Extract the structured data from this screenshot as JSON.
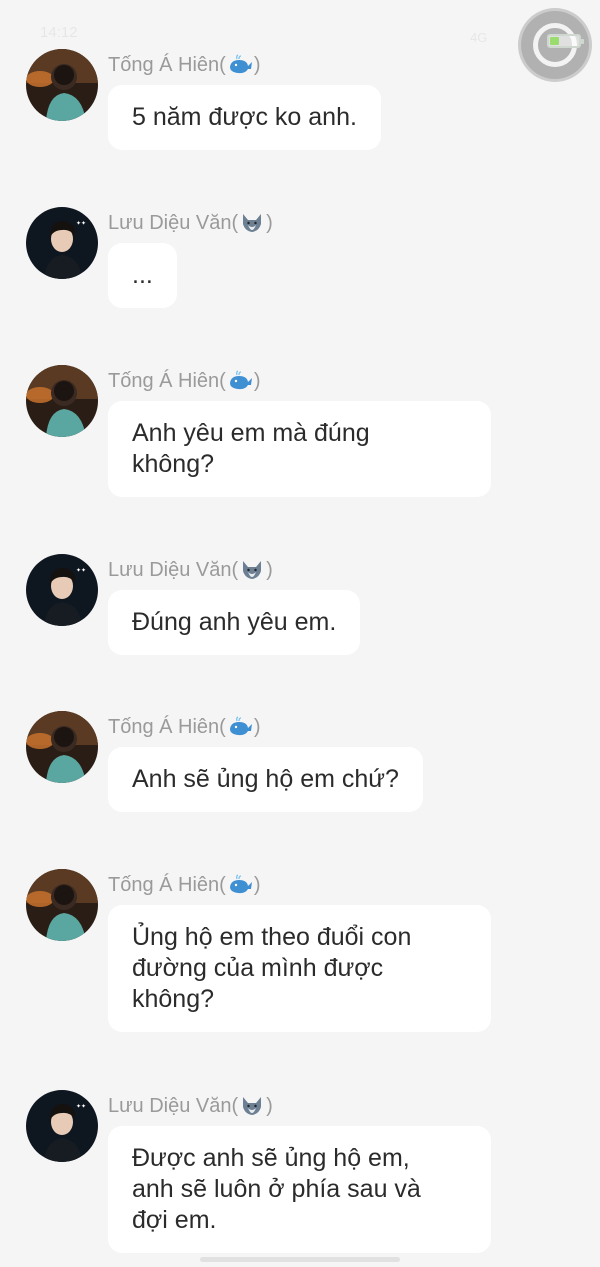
{
  "status_bar": {
    "left_text": "14:12",
    "right_text": "4G"
  },
  "senders": {
    "a": {
      "name": "Tống Á Hiên",
      "emoji": "whale-icon"
    },
    "b": {
      "name": "Lưu Diệu Văn",
      "emoji": "wolf-icon"
    }
  },
  "messages": [
    {
      "sender": "Tống Á Hiên",
      "text": "5 năm được ko anh."
    },
    {
      "sender": "Lưu Diệu Văn",
      "text": "..."
    },
    {
      "sender": "Tống Á Hiên",
      "text": "Anh yêu em mà đúng\nkhông?"
    },
    {
      "sender": "Lưu Diệu Văn",
      "text": "Đúng anh yêu em."
    },
    {
      "sender": "Tống Á Hiên",
      "text": "Anh sẽ ủng hộ em chứ?"
    },
    {
      "sender": "Tống Á Hiên",
      "text": "Ủng hộ em theo đuổi con\nđường của mình được\nkhông?"
    },
    {
      "sender": "Lưu Diệu Văn",
      "text": "Được anh sẽ ủng hộ em,\nanh sẽ luôn ở phía sau và\nđợi em."
    }
  ],
  "colors": {
    "background": "#f5f5f5",
    "bubble": "#ffffff",
    "sender_name": "#9a9a9a",
    "message_text": "#2b2b2b"
  }
}
